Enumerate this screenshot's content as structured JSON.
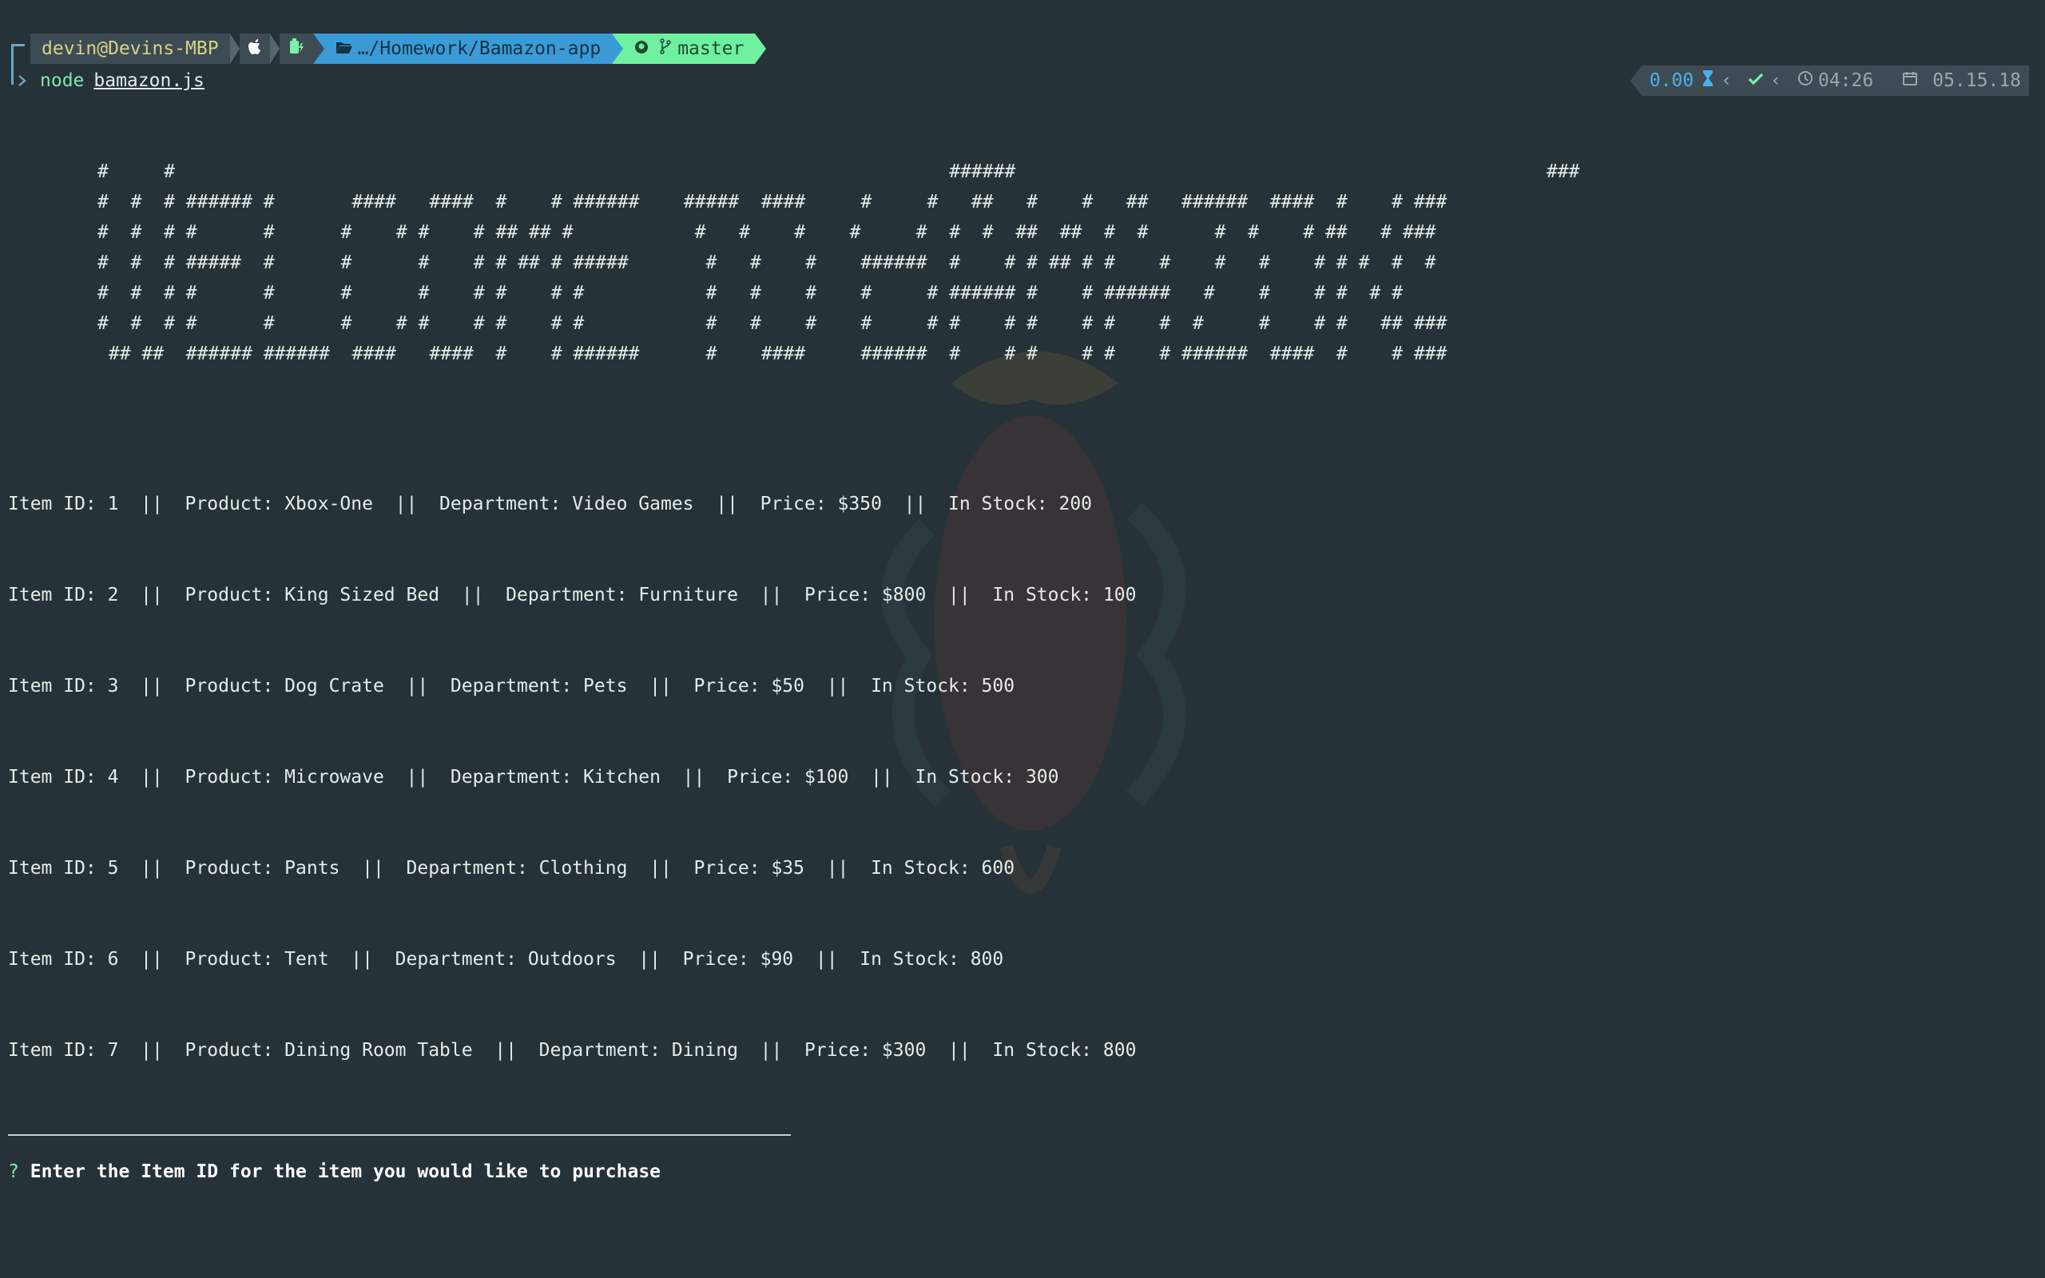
{
  "prompt": {
    "user_host": "devin@Devins-MBP",
    "os_icon": "apple-icon",
    "battery_icon": "battery-charging-icon",
    "directory": "…/Homework/Bamazon-app",
    "folder_icon": "folder-open-icon",
    "git_icon": "github-icon",
    "branch_icon": "git-branch-icon",
    "branch": "master",
    "command": "node",
    "argument": "bamazon.js"
  },
  "right_status": {
    "exec_time": "0.00",
    "hourglass_icon": "hourglass-icon",
    "status_icon": "check-icon",
    "clock_icon": "clock-icon",
    "time": "04:26",
    "calendar_icon": "calendar-icon",
    "date": "05.15.18"
  },
  "banner": [
    "#     #                                                                      ######                                                ###",
    "#  #  # ###### #       ####   ####  #    # ######    #####  ####     #     #   ##   #    #   ##   ######  ####  #    # ###",
    "#  #  # #      #      #    # #    # ## ## #           #   #    #    #     #  #  #  ##  ##  #  #      #  #    # ##   # ###",
    "#  #  # #####  #      #      #    # # ## # #####       #   #    #    ######  #    # # ## # #    #    #   #    # # #  #  #",
    "#  #  # #      #      #      #    # #    # #           #   #    #    #     # ###### #    # ######   #    #    # #  # #",
    "#  #  # #      #      #    # #    # #    # #           #   #    #    #     # #    # #    # #    #  #     #    # #   ## ###",
    " ## ##  ###### ######  ####   ####  #    # ######      #    ####     ######  #    # #    # #    # ######  ####  #    # ###"
  ],
  "items": [
    "Item ID: 1  ||  Product: Xbox-One  ||  Department: Video Games  ||  Price: $350  ||  In Stock: 200",
    "Item ID: 2  ||  Product: King Sized Bed  ||  Department: Furniture  ||  Price: $800  ||  In Stock: 100",
    "Item ID: 3  ||  Product: Dog Crate  ||  Department: Pets  ||  Price: $50  ||  In Stock: 500",
    "Item ID: 4  ||  Product: Microwave  ||  Department: Kitchen  ||  Price: $100  ||  In Stock: 300",
    "Item ID: 5  ||  Product: Pants  ||  Department: Clothing  ||  Price: $35  ||  In Stock: 600",
    "Item ID: 6  ||  Product: Tent  ||  Department: Outdoors  ||  Price: $90  ||  In Stock: 800",
    "Item ID: 7  ||  Product: Dining Room Table  ||  Department: Dining  ||  Price: $300  ||  In Stock: 800"
  ],
  "question": {
    "mark": "?",
    "text": "Enter the Item ID for the item you would like to purchase"
  },
  "colors": {
    "background": "#263238",
    "accent_blue": "#3a9bd6",
    "accent_green": "#6ff0a0",
    "user_yellow": "#d9d283"
  }
}
